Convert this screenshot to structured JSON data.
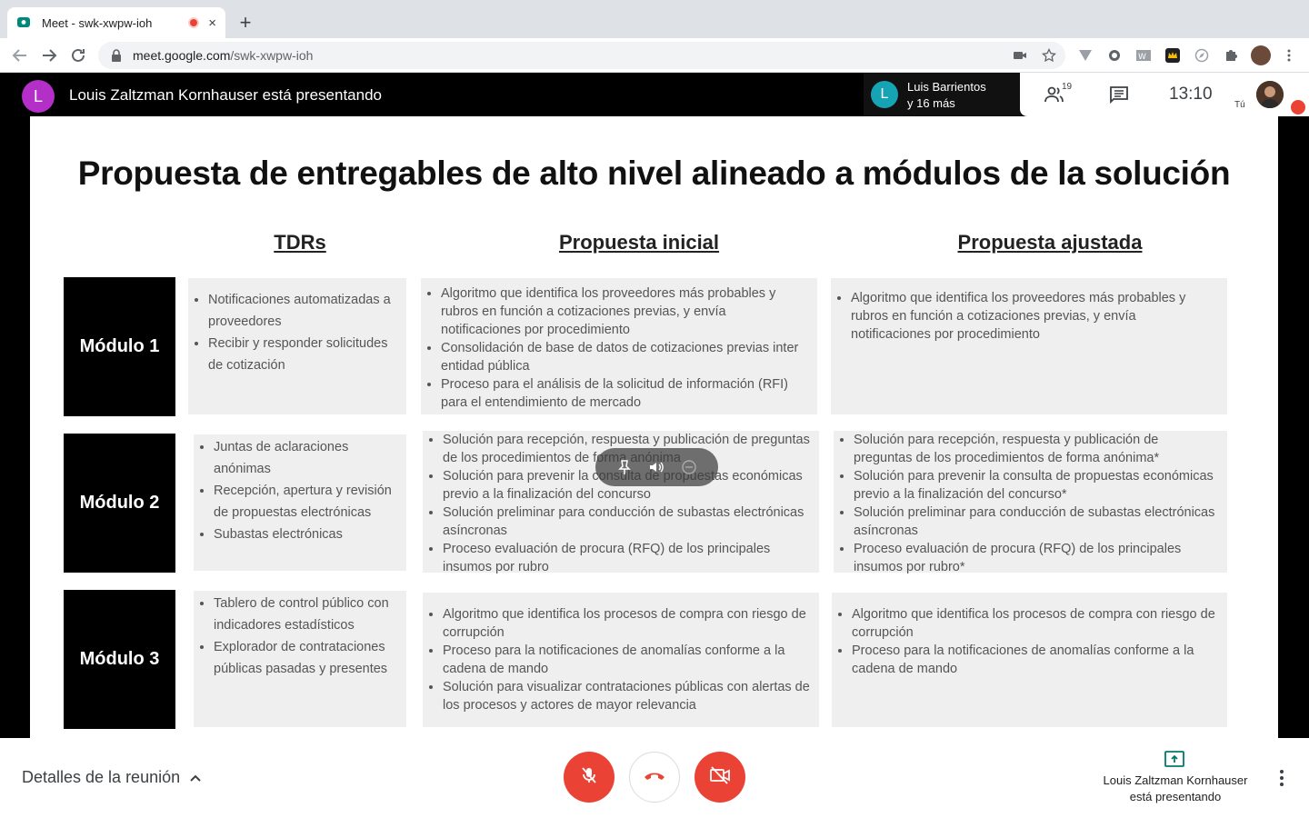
{
  "browser": {
    "tab_title": "Meet - swk-xwpw-ioh",
    "close_label": "×",
    "new_tab_label": "+",
    "url_host": "meet.google.com",
    "url_path": "/swk-xwpw-ioh"
  },
  "header": {
    "presenter_initial": "L",
    "presenting_text": "Louis Zaltzman Kornhauser está presentando",
    "speaker_initial": "L",
    "speaker_name": "Luis Barrientos",
    "speaker_more": "y 16 más",
    "participant_count": "19",
    "time": "13:10",
    "self_label": "Tú"
  },
  "slide": {
    "title": "Propuesta de entregables de alto nivel alineado a módulos de la solución",
    "columns": [
      "TDRs",
      "Propuesta inicial",
      "Propuesta ajustada"
    ],
    "rows": [
      {
        "module": "Módulo 1",
        "tdrs": [
          "Notificaciones automatizadas a proveedores",
          "Recibir y responder solicitudes de cotización"
        ],
        "initial": [
          "Algoritmo que identifica los proveedores más probables y rubros en función a cotizaciones previas, y envía notificaciones por procedimiento",
          "Consolidación de base de datos de cotizaciones previas inter entidad pública",
          "Proceso para el análisis de la solicitud de información (RFI) para el entendimiento de mercado"
        ],
        "adjusted": [
          "Algoritmo que identifica los proveedores más probables y rubros en función a cotizaciones previas, y envía notificaciones por procedimiento"
        ]
      },
      {
        "module": "Módulo 2",
        "tdrs": [
          "Juntas de aclaraciones anónimas",
          "Recepción, apertura y revisión de propuestas electrónicas",
          "Subastas electrónicas"
        ],
        "initial": [
          "Solución para recepción, respuesta y publicación de preguntas de los procedimientos de forma anónima",
          "Solución para prevenir la consulta de propuestas económicas previo a la finalización del concurso",
          "Solución preliminar para conducción de subastas electrónicas asíncronas",
          "Proceso evaluación de procura (RFQ) de los principales insumos por rubro"
        ],
        "adjusted": [
          "Solución para recepción, respuesta y publicación de preguntas de los procedimientos de forma anónima*",
          "Solución para prevenir la consulta de propuestas económicas previo a la finalización del concurso*",
          "Solución preliminar para conducción de subastas electrónicas asíncronas",
          "Proceso evaluación de procura (RFQ) de los principales insumos por rubro*"
        ]
      },
      {
        "module": "Módulo 3",
        "tdrs": [
          "Tablero de control público con indicadores estadísticos",
          "Explorador de contrataciones públicas pasadas y presentes"
        ],
        "initial": [
          "Algoritmo que identifica los procesos de compra con riesgo de corrupción",
          "Proceso para la notificaciones de anomalías conforme a la cadena de mando",
          "Solución para visualizar contrataciones públicas con alertas de los procesos y actores de mayor relevancia"
        ],
        "adjusted": [
          "Algoritmo que identifica los procesos de compra con riesgo de corrupción",
          "Proceso para la notificaciones de anomalías conforme a la cadena de mando"
        ]
      }
    ]
  },
  "footer": {
    "details_label": "Detalles de la reunión",
    "presenting_line1": "Louis Zaltzman Kornhauser",
    "presenting_line2": "está presentando"
  },
  "colors": {
    "accent_red": "#ea4335",
    "presenter_avatar": "#b42fc7",
    "speaker_avatar": "#16a4b4"
  }
}
